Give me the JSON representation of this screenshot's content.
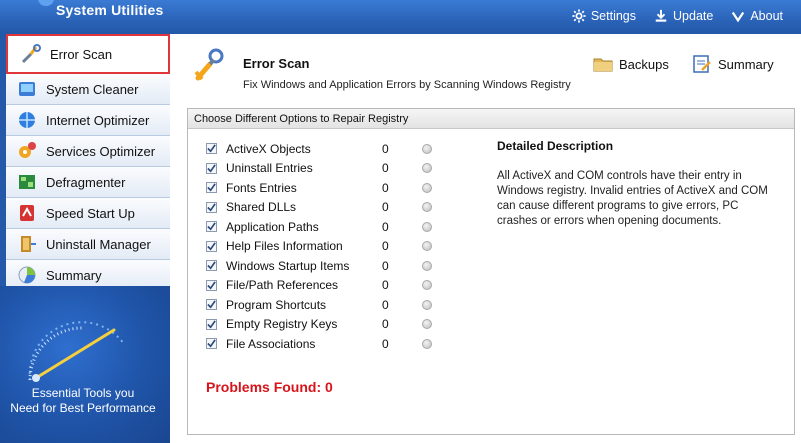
{
  "app": {
    "title": "System Utilities"
  },
  "header_menu": [
    {
      "label": "Settings",
      "icon": "gear-icon"
    },
    {
      "label": "Update",
      "icon": "download-icon"
    },
    {
      "label": "About",
      "icon": "chevron-down-icon"
    }
  ],
  "sidebar": {
    "items": [
      {
        "label": "Error Scan",
        "icon": "wrench-icon",
        "active": true
      },
      {
        "label": "System Cleaner",
        "icon": "cleaner-icon"
      },
      {
        "label": "Internet Optimizer",
        "icon": "globe-icon"
      },
      {
        "label": "Services Optimizer",
        "icon": "services-gear-icon"
      },
      {
        "label": "Defragmenter",
        "icon": "defrag-icon"
      },
      {
        "label": "Speed Start Up",
        "icon": "speed-icon"
      },
      {
        "label": "Uninstall Manager",
        "icon": "uninstall-icon"
      },
      {
        "label": "Summary",
        "icon": "summary-icon"
      }
    ],
    "tagline_line1": "Essential Tools you",
    "tagline_line2": "Need for Best Performance"
  },
  "main": {
    "title": "Error Scan",
    "subtitle": "Fix Windows and Application Errors by Scanning Windows Registry",
    "backups_label": "Backups",
    "summary_label": "Summary",
    "panel_header": "Choose Different Options to Repair Registry",
    "options": [
      {
        "label": "ActiveX Objects",
        "count": "0",
        "checked": true
      },
      {
        "label": "Uninstall Entries",
        "count": "0",
        "checked": true
      },
      {
        "label": "Fonts Entries",
        "count": "0",
        "checked": true
      },
      {
        "label": "Shared DLLs",
        "count": "0",
        "checked": true
      },
      {
        "label": "Application Paths",
        "count": "0",
        "checked": true
      },
      {
        "label": "Help Files Information",
        "count": "0",
        "checked": true
      },
      {
        "label": "Windows Startup Items",
        "count": "0",
        "checked": true
      },
      {
        "label": "File/Path References",
        "count": "0",
        "checked": true
      },
      {
        "label": "Program Shortcuts",
        "count": "0",
        "checked": true
      },
      {
        "label": "Empty Registry Keys",
        "count": "0",
        "checked": true
      },
      {
        "label": "File Associations",
        "count": "0",
        "checked": true
      }
    ],
    "description_title": "Detailed Description",
    "description_text": "All ActiveX and COM controls have their entry in Windows registry. Invalid entries of ActiveX and COM can cause different programs to give errors, PC crashes or errors when opening documents.",
    "problems_found": "Problems Found: 0"
  },
  "colors": {
    "accent": "#2458a8",
    "active_border": "#e0353a",
    "problems_red": "#d7141a"
  }
}
